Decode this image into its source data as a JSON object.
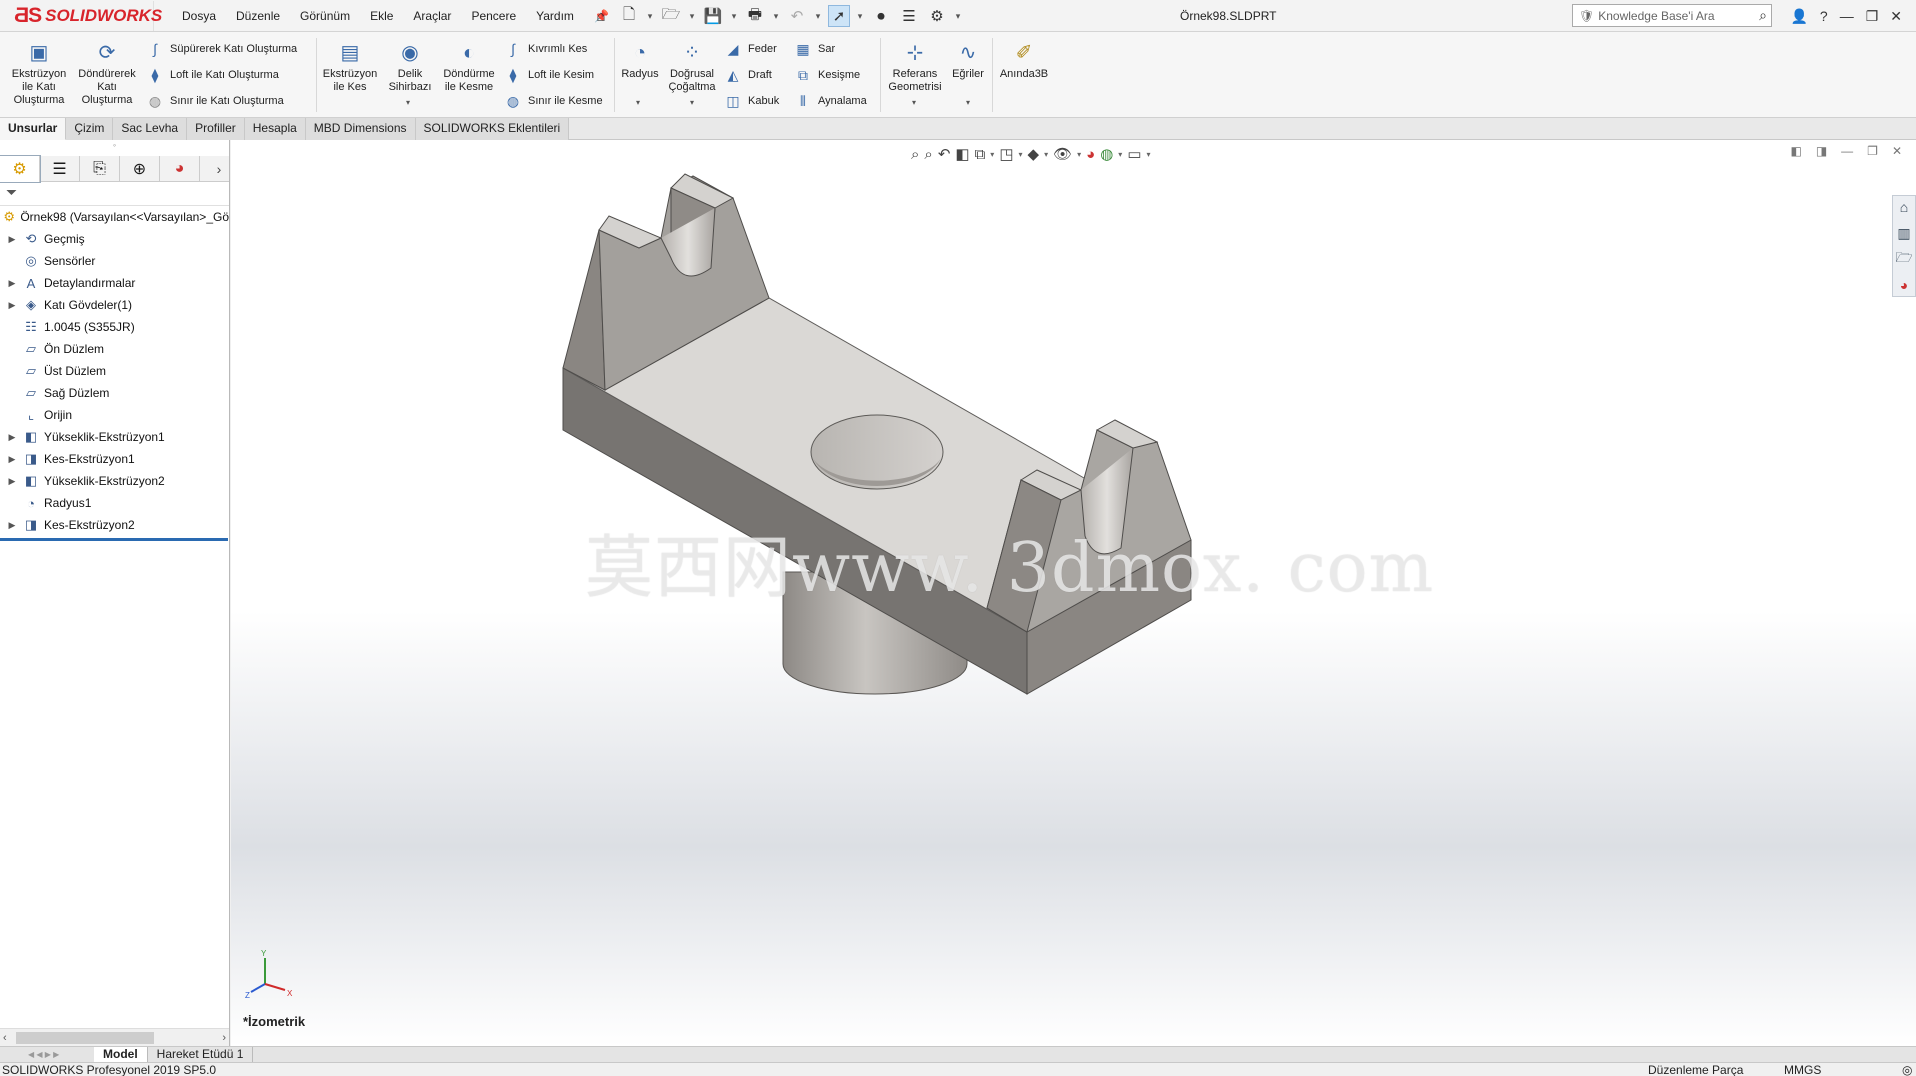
{
  "app": {
    "brand": "SOLIDWORKS",
    "document_title": "Örnek98.SLDPRT",
    "menu": [
      "Dosya",
      "Düzenle",
      "Görünüm",
      "Ekle",
      "Araçlar",
      "Pencere",
      "Yardım"
    ],
    "search_placeholder": "Knowledge Base'i Ara"
  },
  "ribbon": {
    "boss_extrude": "Ekstrüzyon ile Katı Oluşturma",
    "revolve": "Döndürerek Katı Oluşturma",
    "sweep": "Süpürerek Katı Oluşturma",
    "loft": "Loft ile Katı Oluşturma",
    "boundary": "Sınır ile Katı Oluşturma",
    "cut_extrude": "Ekstrüzyon ile Kes",
    "hole_wizard": "Delik Sihirbazı",
    "revolve_cut": "Döndürme ile Kesme",
    "swept_cut": "Kıvrımlı Kes",
    "loft_cut": "Loft ile Kesim",
    "boundary_cut": "Sınır ile Kesme",
    "fillet": "Radyus",
    "linear_pattern": "Doğrusal Çoğaltma",
    "rib": "Feder",
    "draft": "Draft",
    "shell": "Kabuk",
    "wrap": "Sar",
    "intersect": "Kesişme",
    "mirror": "Aynalama",
    "ref_geometry": "Referans Geometrisi",
    "curves": "Eğriler",
    "instant3d": "Anında3B"
  },
  "tabs": [
    "Unsurlar",
    "Çizim",
    "Sac Levha",
    "Profiller",
    "Hesapla",
    "MBD Dimensions",
    "SOLIDWORKS Eklentileri"
  ],
  "tree": {
    "root": "Örnek98  (Varsayılan<<Varsayılan>_Gö",
    "items": [
      {
        "label": "Geçmiş",
        "expandable": true,
        "icon": "history-icon",
        "glyph": "⟲"
      },
      {
        "label": "Sensörler",
        "expandable": false,
        "icon": "sensor-icon",
        "glyph": "◎"
      },
      {
        "label": "Detaylandırmalar",
        "expandable": true,
        "icon": "annotation-icon",
        "glyph": "A"
      },
      {
        "label": "Katı Gövdeler(1)",
        "expandable": true,
        "icon": "solid-bodies-icon",
        "glyph": "◈"
      },
      {
        "label": "1.0045 (S355JR)",
        "expandable": false,
        "icon": "material-icon",
        "glyph": "☷"
      },
      {
        "label": "Ön Düzlem",
        "expandable": false,
        "icon": "plane-icon",
        "glyph": "▱"
      },
      {
        "label": "Üst Düzlem",
        "expandable": false,
        "icon": "plane-icon",
        "glyph": "▱"
      },
      {
        "label": "Sağ Düzlem",
        "expandable": false,
        "icon": "plane-icon",
        "glyph": "▱"
      },
      {
        "label": "Orijin",
        "expandable": false,
        "icon": "origin-icon",
        "glyph": "⌞"
      },
      {
        "label": "Yükseklik-Ekstrüzyon1",
        "expandable": true,
        "icon": "boss-extrude-icon",
        "glyph": "◧"
      },
      {
        "label": "Kes-Ekstrüzyon1",
        "expandable": true,
        "icon": "cut-extrude-icon",
        "glyph": "◨"
      },
      {
        "label": "Yükseklik-Ekstrüzyon2",
        "expandable": true,
        "icon": "boss-extrude-icon",
        "glyph": "◧"
      },
      {
        "label": "Radyus1",
        "expandable": false,
        "icon": "fillet-icon",
        "glyph": "◔"
      },
      {
        "label": "Kes-Ekstrüzyon2",
        "expandable": true,
        "icon": "cut-extrude-icon",
        "glyph": "◨"
      }
    ]
  },
  "viewport": {
    "view_name": "*İzometrik",
    "watermark": "莫西网www. 3dmox. com",
    "triad_labels": [
      "Y",
      "Z",
      "X"
    ]
  },
  "bottom_tabs": [
    "Model",
    "Hareket Etüdü 1"
  ],
  "status": {
    "version": "SOLIDWORKS Profesyonel 2019 SP5.0",
    "mode": "Düzenleme Parça",
    "units": "MMGS"
  },
  "colors": {
    "accent": "#d8242b",
    "selection": "#2a6ab1",
    "part_light": "#d9d7d4",
    "part_mid": "#a6a29e",
    "part_dark": "#7a7774"
  }
}
